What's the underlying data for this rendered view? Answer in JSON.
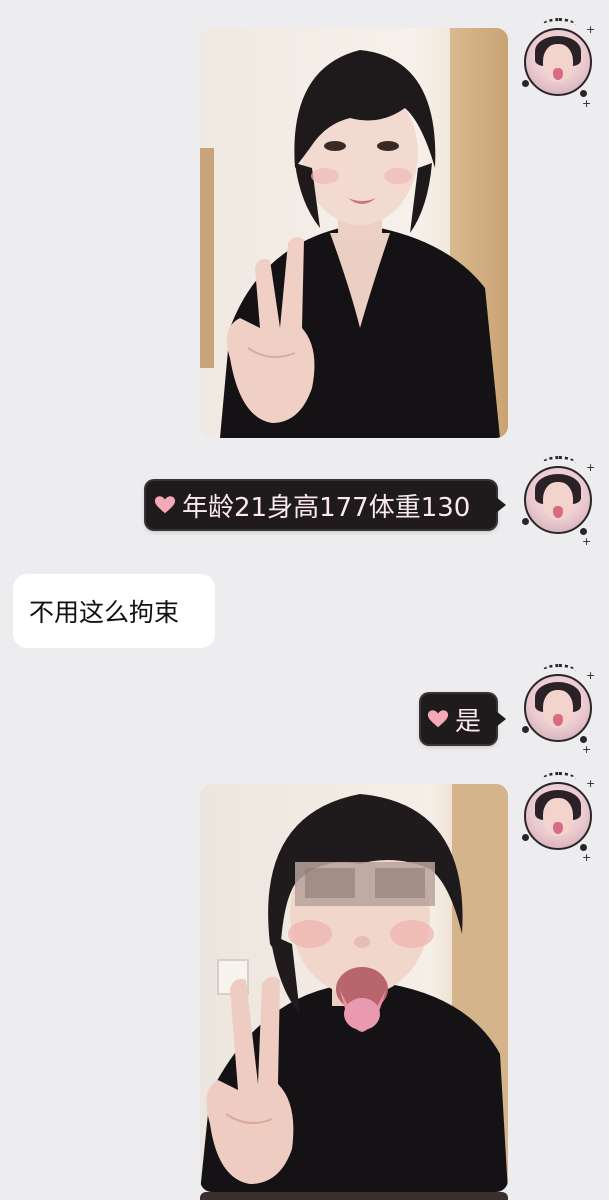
{
  "conversation": {
    "messages": [
      {
        "id": "m1",
        "sender": "self",
        "type": "image",
        "description_icon": "selfie-photo"
      },
      {
        "id": "m2",
        "sender": "self",
        "type": "text",
        "text": "年龄21身高177体重130"
      },
      {
        "id": "m3",
        "sender": "other",
        "type": "text",
        "text": "不用这么拘束"
      },
      {
        "id": "m4",
        "sender": "self",
        "type": "text",
        "text": "是"
      },
      {
        "id": "m5",
        "sender": "self",
        "type": "image",
        "description_icon": "selfie-photo"
      }
    ]
  },
  "icons": {
    "bubble_heart": "heart-icon",
    "avatar": "user-avatar-icon"
  },
  "colors": {
    "background": "#ededf0",
    "dark_bubble": "#1f1b1d",
    "dark_bubble_text": "#fbe9ee",
    "heart": "#f3a9b8",
    "light_bubble": "#ffffff"
  }
}
